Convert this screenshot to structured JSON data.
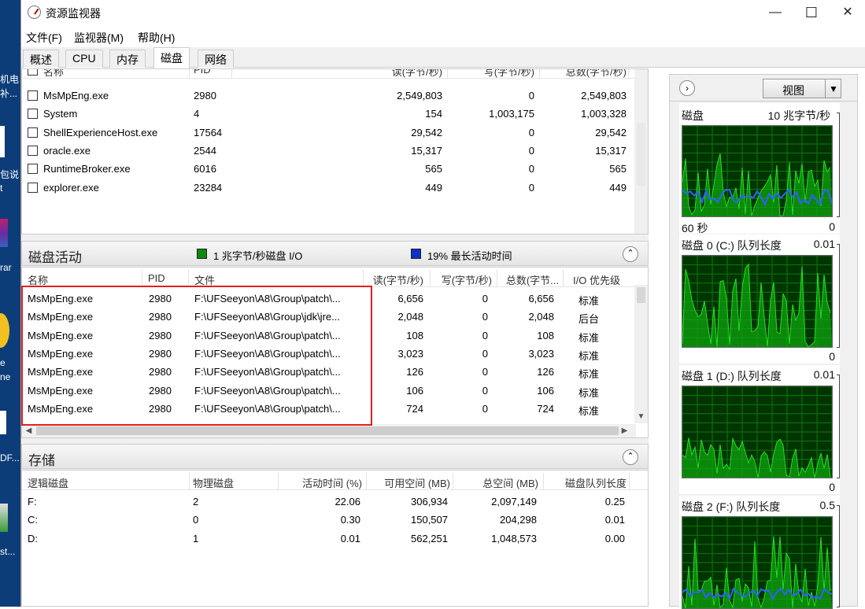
{
  "desktop": {
    "labels": [
      "机电",
      "补...",
      "包说",
      "t",
      "rar",
      "e",
      "ne",
      "DF...",
      "st..."
    ]
  },
  "window": {
    "title": "资源监视器",
    "controls": {
      "minimize": "—",
      "maximize": "☐",
      "close": "✕"
    }
  },
  "menubar": {
    "items": [
      "文件(F)",
      "监视器(M)",
      "帮助(H)"
    ]
  },
  "tabs": [
    {
      "label": "概述",
      "active": false
    },
    {
      "label": "CPU",
      "active": false
    },
    {
      "label": "内存",
      "active": false
    },
    {
      "label": "磁盘",
      "active": true
    },
    {
      "label": "网络",
      "active": false
    }
  ],
  "processes": {
    "headers": {
      "name": "名称",
      "pid": "PID",
      "read": "读(字节/秒)",
      "write": "写(字节/秒)",
      "total": "总数(字节/秒)"
    },
    "rows": [
      {
        "name": "MsMpEng.exe",
        "pid": "2980",
        "read": "2,549,803",
        "write": "0",
        "total": "2,549,803"
      },
      {
        "name": "System",
        "pid": "4",
        "read": "154",
        "write": "1,003,175",
        "total": "1,003,328"
      },
      {
        "name": "ShellExperienceHost.exe",
        "pid": "17564",
        "read": "29,542",
        "write": "0",
        "total": "29,542"
      },
      {
        "name": "oracle.exe",
        "pid": "2544",
        "read": "15,317",
        "write": "0",
        "total": "15,317"
      },
      {
        "name": "RuntimeBroker.exe",
        "pid": "6016",
        "read": "565",
        "write": "0",
        "total": "565"
      },
      {
        "name": "explorer.exe",
        "pid": "23284",
        "read": "449",
        "write": "0",
        "total": "449"
      }
    ]
  },
  "disk_activity": {
    "title": "磁盘活动",
    "io_label": "1 兆字节/秒磁盘 I/O",
    "io_color": "#0a8a0a",
    "active_label": "19% 最长活动时间",
    "active_color": "#1030c8",
    "headers": {
      "name": "名称",
      "pid": "PID",
      "file": "文件",
      "read": "读(字节/秒)",
      "write": "写(字节/秒)",
      "total": "总数(字节...",
      "priority": "I/O 优先级"
    },
    "rows": [
      {
        "name": "MsMpEng.exe",
        "pid": "2980",
        "file": "F:\\UFSeeyon\\A8\\Group\\patch\\...",
        "read": "6,656",
        "write": "0",
        "total": "6,656",
        "priority": "标准"
      },
      {
        "name": "MsMpEng.exe",
        "pid": "2980",
        "file": "F:\\UFSeeyon\\A8\\Group\\jdk\\jre...",
        "read": "2,048",
        "write": "0",
        "total": "2,048",
        "priority": "后台"
      },
      {
        "name": "MsMpEng.exe",
        "pid": "2980",
        "file": "F:\\UFSeeyon\\A8\\Group\\patch\\...",
        "read": "108",
        "write": "0",
        "total": "108",
        "priority": "标准"
      },
      {
        "name": "MsMpEng.exe",
        "pid": "2980",
        "file": "F:\\UFSeeyon\\A8\\Group\\patch\\...",
        "read": "3,023",
        "write": "0",
        "total": "3,023",
        "priority": "标准"
      },
      {
        "name": "MsMpEng.exe",
        "pid": "2980",
        "file": "F:\\UFSeeyon\\A8\\Group\\patch\\...",
        "read": "126",
        "write": "0",
        "total": "126",
        "priority": "标准"
      },
      {
        "name": "MsMpEng.exe",
        "pid": "2980",
        "file": "F:\\UFSeeyon\\A8\\Group\\patch\\...",
        "read": "106",
        "write": "0",
        "total": "106",
        "priority": "标准"
      },
      {
        "name": "MsMpEng.exe",
        "pid": "2980",
        "file": "F:\\UFSeeyon\\A8\\Group\\patch\\...",
        "read": "724",
        "write": "0",
        "total": "724",
        "priority": "标准"
      }
    ]
  },
  "storage": {
    "title": "存储",
    "headers": {
      "logical": "逻辑磁盘",
      "physical": "物理磁盘",
      "active": "活动时间 (%)",
      "free": "可用空间 (MB)",
      "total": "总空间 (MB)",
      "queue": "磁盘队列长度"
    },
    "rows": [
      {
        "logical": "F:",
        "physical": "2",
        "active": "22.06",
        "free": "306,934",
        "total": "2,097,149",
        "queue": "0.25"
      },
      {
        "logical": "C:",
        "physical": "0",
        "active": "0.30",
        "free": "150,507",
        "total": "204,298",
        "queue": "0.01"
      },
      {
        "logical": "D:",
        "physical": "1",
        "active": "0.01",
        "free": "562,251",
        "total": "1,048,573",
        "queue": "0.00"
      }
    ]
  },
  "graphs": {
    "view_button": "视图",
    "disk": {
      "label": "磁盘",
      "scale": "10 兆字节/秒",
      "time": "60 秒",
      "min": "0"
    },
    "disk0": {
      "label": "磁盘 0 (C:) 队列长度",
      "max": "0.01",
      "min": "0"
    },
    "disk1": {
      "label": "磁盘 1 (D:) 队列长度",
      "max": "0.01",
      "min": "0"
    },
    "disk2": {
      "label": "磁盘 2 (F:) 队列长度",
      "max": "0.5"
    },
    "colors": {
      "background": "#003400",
      "grid": "#0d7a0d",
      "green": "#22e022",
      "blue": "#3060ff"
    }
  }
}
